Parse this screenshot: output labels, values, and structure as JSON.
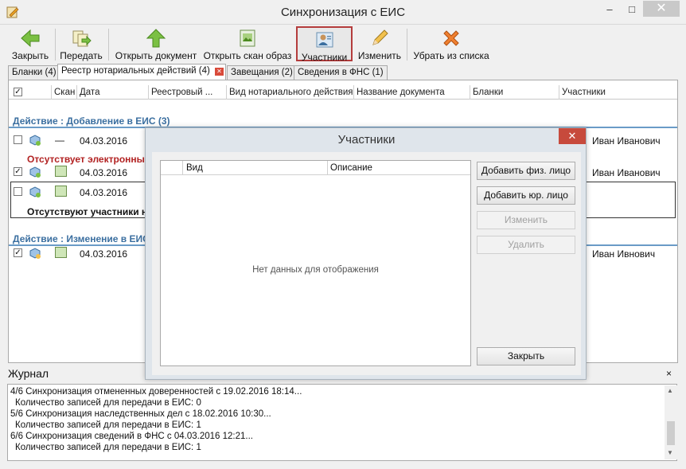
{
  "window": {
    "title": "Синхронизация с ЕИС",
    "minimize": "–",
    "maximize": "□",
    "close": "✕"
  },
  "toolbar": {
    "close": "Закрыть",
    "send": "Передать",
    "open_document": "Открыть документ",
    "open_scan": "Открыть скан образ",
    "participants": "Участники",
    "edit": "Изменить",
    "remove_from_list": "Убрать из списка"
  },
  "tabs": [
    {
      "label": "Бланки (4)"
    },
    {
      "label": "Реестр нотариальных действий (4)"
    },
    {
      "label": "Завещания (2)"
    },
    {
      "label": "Сведения в ФНС (1)"
    }
  ],
  "grid": {
    "columns": [
      "Скан",
      "Дата",
      "Реестровый ...",
      "Вид нотариального действия",
      "Название документа",
      "Бланки",
      "Участники"
    ],
    "group1": "Действие : Добавление в ЕИС (3)",
    "group2": "Действие : Изменение в ЕИС",
    "rows": [
      {
        "checked": "",
        "scan": "—",
        "date": "04.03.2016",
        "participant": "Иван Иванович"
      },
      {
        "checked": "✓",
        "scan": "",
        "date": "04.03.2016",
        "participant": "Иван Иванович"
      },
      {
        "checked": "",
        "scan": "",
        "date": "04.03.2016",
        "participant": ""
      },
      {
        "checked": "✓",
        "scan": "",
        "date": "04.03.2016",
        "participant": "Иван Ивнович"
      }
    ],
    "warn1": "Отсутствует электронны",
    "warn2": "Отсутствуют участники н"
  },
  "modal": {
    "title": "Участники",
    "close": "✕",
    "col_kind": "Вид",
    "col_desc": "Описание",
    "empty": "Нет данных для отображения",
    "add_person": "Добавить физ. лицо",
    "add_legal": "Добавить юр. лицо",
    "edit": "Изменить",
    "delete": "Удалить",
    "close_button": "Закрыть"
  },
  "journal": {
    "title": "Журнал",
    "close": "×",
    "lines": [
      "4/6 Синхронизация отмененных доверенностей с 19.02.2016 18:14...",
      "  Количество записей для передачи в ЕИС: 0",
      "5/6 Синхронизация наследственных дел с 18.02.2016 10:30...",
      "  Количество записей для передачи в ЕИС: 1",
      "6/6 Синхронизация сведений в ФНС с 04.03.2016 12:21...",
      "  Количество записей для передачи в ЕИС: 1"
    ]
  },
  "colors": {
    "accent": "#3b6fa0",
    "warning": "#b22222",
    "close_red": "#c74a3c"
  }
}
